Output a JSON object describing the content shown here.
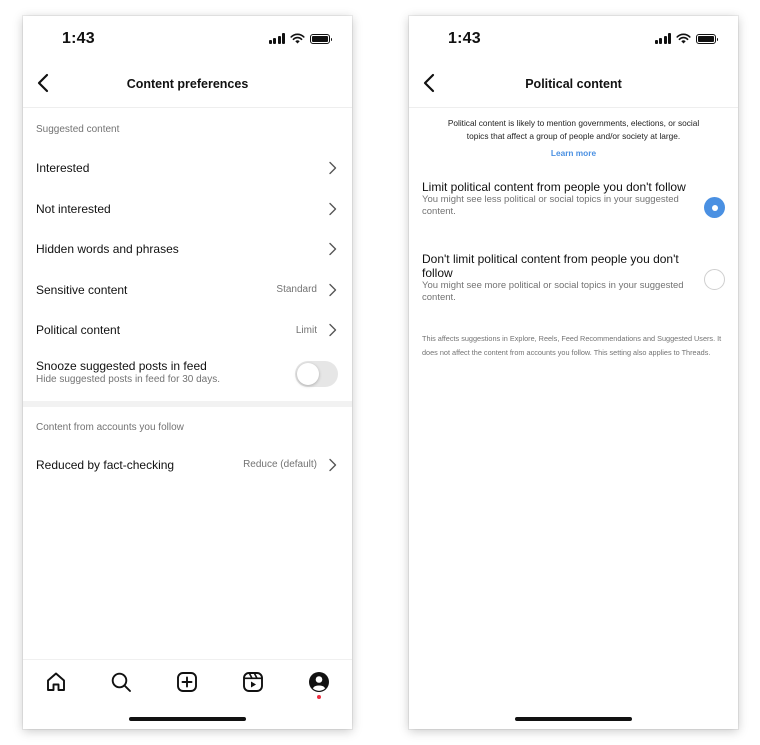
{
  "left_screen": {
    "status": {
      "time": "1:43"
    },
    "header": {
      "title": "Content preferences"
    },
    "sections": [
      {
        "heading": "Suggested content",
        "rows": [
          {
            "label": "Interested",
            "value": ""
          },
          {
            "label": "Not interested",
            "value": ""
          },
          {
            "label": "Hidden words and phrases",
            "value": ""
          },
          {
            "label": "Sensitive content",
            "value": "Standard"
          },
          {
            "label": "Political content",
            "value": "Limit"
          }
        ],
        "toggle_row": {
          "label": "Snooze suggested posts in feed",
          "sub": "Hide suggested posts in feed for 30 days.",
          "enabled": false
        }
      },
      {
        "heading": "Content from accounts you follow",
        "rows": [
          {
            "label": "Reduced by fact-checking",
            "value": "Reduce (default)"
          }
        ]
      }
    ],
    "tabs": [
      "home-icon",
      "search-icon",
      "create-icon",
      "reels-icon",
      "profile-icon"
    ],
    "accent_notification": "#ed2f41"
  },
  "right_screen": {
    "status": {
      "time": "1:43"
    },
    "header": {
      "title": "Political content"
    },
    "intro": "Political content is likely to mention governments, elections, or social topics that affect a group of people and/or society at large.",
    "learn_more": "Learn more",
    "options": [
      {
        "title": "Limit political content from people you don't follow",
        "desc": "You might see less political or social topics in your suggested content.",
        "selected": true
      },
      {
        "title": "Don't limit political content from people you don't follow",
        "desc": "You might see more political or social topics in your suggested content.",
        "selected": false
      }
    ],
    "footnote": "This affects suggestions in Explore, Reels, Feed Recommendations and Suggested Users. It does not affect the content from accounts you follow. This setting also applies to Threads.",
    "accent": "#4a90e2"
  }
}
